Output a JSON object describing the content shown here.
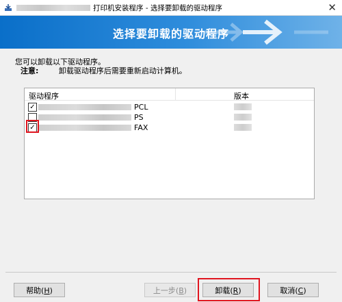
{
  "window": {
    "title": "打印机安装程序 - 选择要卸载的驱动程序",
    "close_glyph": "✕"
  },
  "banner": {
    "heading": "选择要卸载的驱动程序"
  },
  "intro_text": "您可以卸载以下驱动程序。",
  "note": {
    "label": "注意:",
    "text": "卸载驱动程序后需要重新启动计算机。"
  },
  "list": {
    "columns": {
      "name": "驱动程序",
      "version": "版本"
    },
    "rows": [
      {
        "suffix": "PCL",
        "checked": true,
        "check_glyph": "✓"
      },
      {
        "suffix": "PS",
        "checked": false,
        "check_glyph": ""
      },
      {
        "suffix": "FAX",
        "checked": true,
        "check_glyph": "✓"
      }
    ]
  },
  "buttons": {
    "help": {
      "label": "帮助(",
      "key": "H",
      "end": ")"
    },
    "back": {
      "label": "上一步(",
      "key": "B",
      "end": ")"
    },
    "uninstall": {
      "label": "卸载(",
      "key": "R",
      "end": ")"
    },
    "cancel": {
      "label": "取消(",
      "key": "C",
      "end": ")"
    }
  },
  "colors": {
    "banner_start": "#0a6fc9",
    "banner_end": "#6fb2e8",
    "highlight": "#e0141e"
  }
}
